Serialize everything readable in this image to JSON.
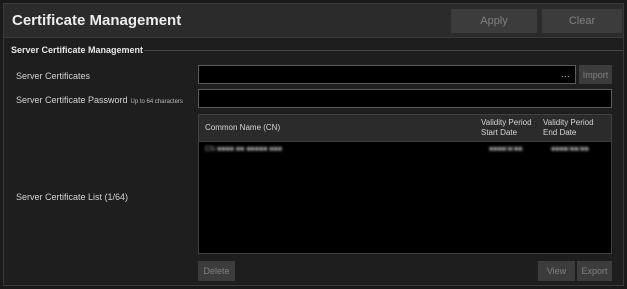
{
  "header": {
    "title": "Certificate Management",
    "apply_label": "Apply",
    "clear_label": "Clear"
  },
  "section": {
    "title": "Server Certificate Management"
  },
  "server_certificates": {
    "label": "Server Certificates",
    "value": "",
    "browse": "...",
    "import_label": "Import"
  },
  "password": {
    "label": "Server Certificate Password",
    "note": "Up to 64 characters",
    "value": ""
  },
  "cert_list": {
    "label": "Server Certificate List (1/64)",
    "columns": {
      "cn": "Common Name (CN)",
      "start_line1": "Validity Period",
      "start_line2": "Start Date",
      "end_line1": "Validity Period",
      "end_line2": "End Date"
    },
    "rows": [
      {
        "cn": "CN ■■■■ ■■ ■■■■■ ■■■",
        "start": "■■■■/■/■■",
        "end": "■■■■/■■/■■"
      }
    ]
  },
  "actions": {
    "delete_label": "Delete",
    "view_label": "View",
    "export_label": "Export"
  }
}
